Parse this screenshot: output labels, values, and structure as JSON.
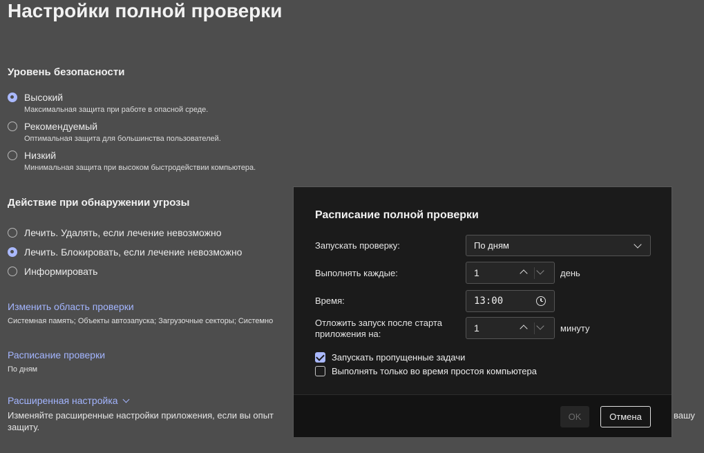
{
  "page": {
    "title": "Настройки полной проверки",
    "security": {
      "heading": "Уровень безопасности",
      "options": [
        {
          "label": "Высокий",
          "desc": "Максимальная защита при работе в опасной среде.",
          "checked": true
        },
        {
          "label": "Рекомендуемый",
          "desc": "Оптимальная защита для большинства пользователей.",
          "checked": false
        },
        {
          "label": "Низкий",
          "desc": "Минимальная защита при высоком быстродействии компьютера.",
          "checked": false
        }
      ]
    },
    "threat": {
      "heading": "Действие при обнаружении угрозы",
      "options": [
        {
          "label": "Лечить. Удалять, если лечение невозможно",
          "checked": false
        },
        {
          "label": "Лечить. Блокировать, если лечение невозможно",
          "checked": true
        },
        {
          "label": "Информировать",
          "checked": false
        }
      ]
    },
    "scope": {
      "link": "Изменить область проверки",
      "summary": "Системная память; Объекты автозапуска; Загрузочные секторы; Системно"
    },
    "schedule": {
      "link": "Расписание проверки",
      "summary": "По дням"
    },
    "advanced": {
      "link": "Расширенная настройка",
      "text_line1": "Изменяйте расширенные настройки приложения, если вы опыт",
      "text_line1_tail": "вашу",
      "text_line2": "защиту."
    }
  },
  "dialog": {
    "title": "Расписание полной проверки",
    "run_label": "Запускать проверку:",
    "run_value": "По дням",
    "every_label": "Выполнять каждые:",
    "every_value": "1",
    "every_unit": "день",
    "time_label": "Время:",
    "time_value": "13:00",
    "delay_label_line1": "Отложить запуск после старта",
    "delay_label_line2": "приложения на:",
    "delay_value": "1",
    "delay_unit": "минуту",
    "missed_tasks_label": "Запускать пропущенные задачи",
    "missed_tasks_checked": true,
    "idle_only_label": "Выполнять только во время простоя компьютера",
    "idle_only_checked": false,
    "ok_label": "OK",
    "cancel_label": "Отмена"
  }
}
